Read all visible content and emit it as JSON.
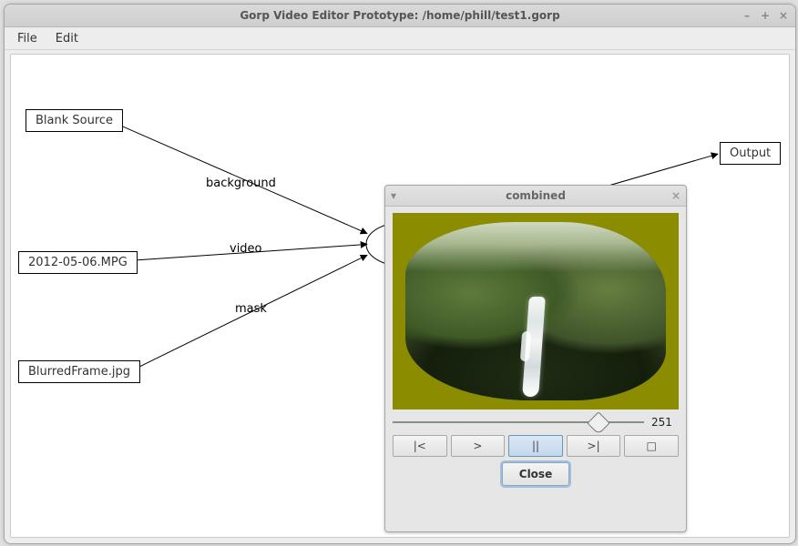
{
  "window": {
    "title": "Gorp Video Editor Prototype: /home/phill/test1.gorp",
    "controls": {
      "min": "–",
      "max": "+",
      "close": "×"
    }
  },
  "menubar": {
    "items": [
      "File",
      "Edit"
    ]
  },
  "graph": {
    "nodes": {
      "blank": {
        "label": "Blank Source"
      },
      "mpg": {
        "label": "2012-05-06.MPG"
      },
      "blurred": {
        "label": "BlurredFrame.jpg"
      },
      "output": {
        "label": "Output"
      }
    },
    "edges": {
      "bg": {
        "label": "background"
      },
      "video": {
        "label": "video"
      },
      "mask": {
        "label": "mask"
      }
    },
    "combine_node_hidden_behind_preview": true
  },
  "preview": {
    "title": "combined",
    "frame_value": "251",
    "slider_position_pct": 82,
    "buttons": {
      "first": "|<",
      "play": ">",
      "pause": "||",
      "last": ">|",
      "stop": "□"
    },
    "close_label": "Close"
  }
}
